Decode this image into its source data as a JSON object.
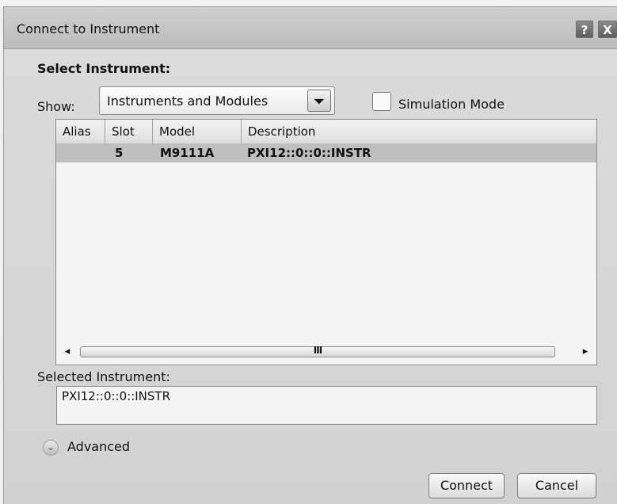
{
  "window": {
    "title": "Connect to Instrument",
    "help_label": "?",
    "close_label": "X"
  },
  "select_section": {
    "heading": "Select Instrument:",
    "show_label": "Show:",
    "show_value": "Instruments and Modules",
    "combo_arrow": "⏷",
    "simulation_label": "Simulation Mode",
    "simulation_checked": false
  },
  "table": {
    "columns": [
      "Alias",
      "Slot",
      "Model",
      "Description"
    ],
    "rows": [
      {
        "alias": "",
        "slot": "5",
        "model": "M9111A",
        "description": "PXI12::0::0::INSTR"
      }
    ],
    "scroll_left": "◂",
    "scroll_right": "▸",
    "scroll_grip": "III"
  },
  "selected": {
    "label": "Selected Instrument:",
    "value": "PXI12::0::0::INSTR"
  },
  "advanced": {
    "label": "Advanced",
    "icon": "⌄"
  },
  "buttons": {
    "connect": "Connect",
    "cancel": "Cancel"
  },
  "colors": {
    "title_bg": "#c6c6c6",
    "dialog_bg": "#d6d6d6",
    "selected_row": "#bfbfbf"
  }
}
